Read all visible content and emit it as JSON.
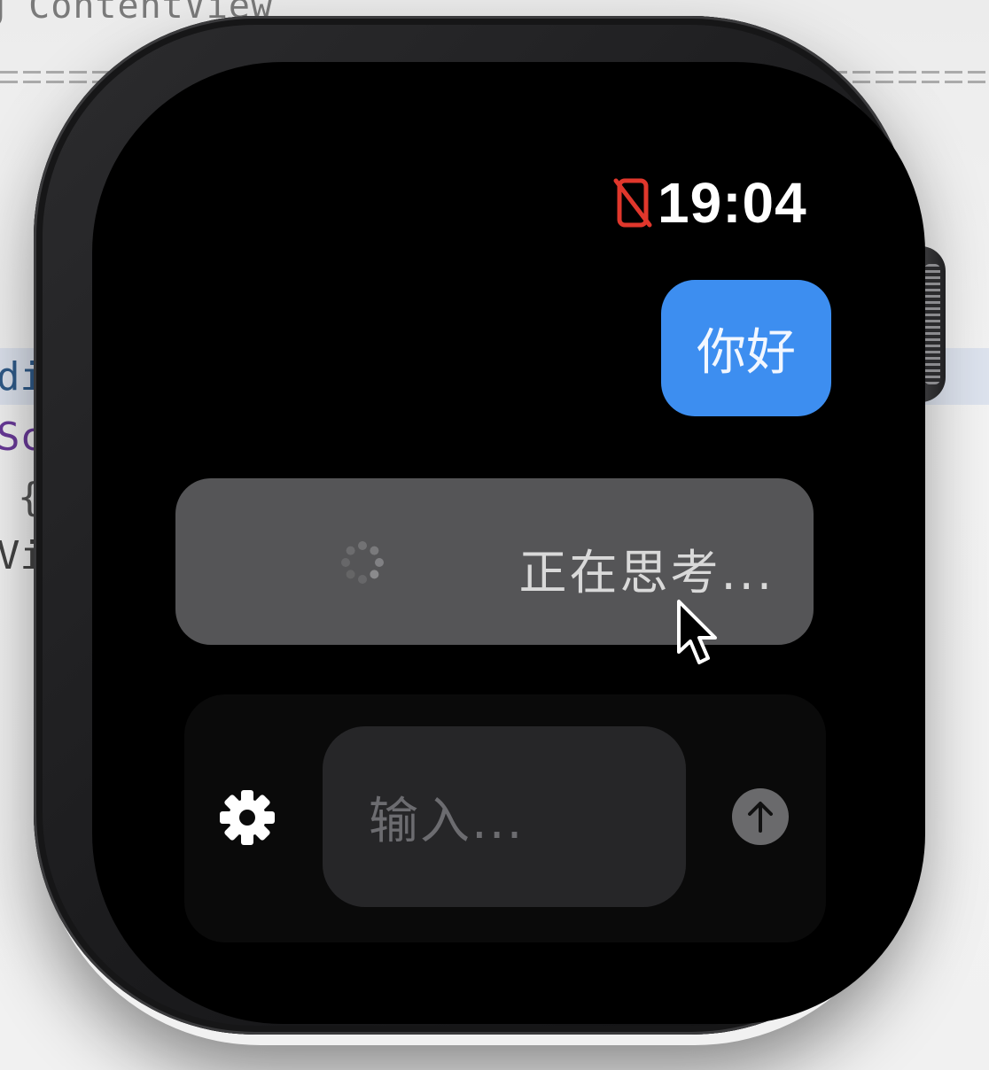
{
  "editor": {
    "title": "g ContentView",
    "code_lines": [
      "di",
      "Sc",
      "{",
      "Vi"
    ]
  },
  "status_bar": {
    "time": "19:04",
    "disconnected_icon": "iphone-slash-icon",
    "disconnected_color": "#e0372c"
  },
  "chat": {
    "user_message": "你好",
    "user_bubble_color": "#3d8ef0",
    "thinking_text": "正在思考...",
    "spinner_icon": "activity-spinner-icon"
  },
  "input": {
    "placeholder": "输入...",
    "settings_icon": "gear-icon",
    "send_icon": "arrow-up-circle-icon"
  },
  "pointer": {
    "icon": "mouse-pointer-icon"
  }
}
